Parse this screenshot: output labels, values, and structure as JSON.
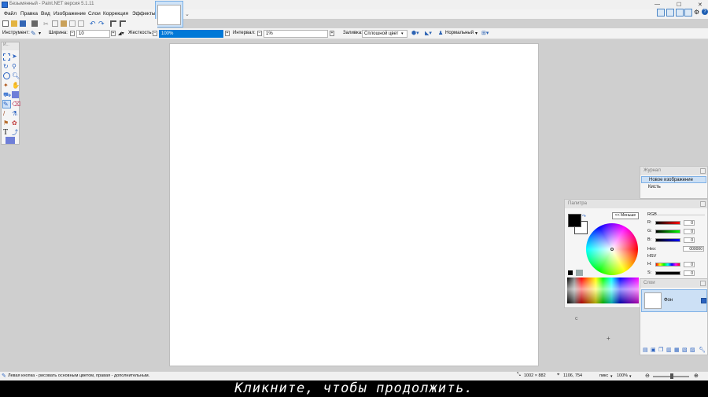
{
  "window": {
    "title": "Безымянный - Paint.NET версия 5.1.11"
  },
  "menu": {
    "items": [
      "Файл",
      "Правка",
      "Вид",
      "Изображение",
      "Слои",
      "Коррекция",
      "Эффекты"
    ]
  },
  "options": {
    "tool_label": "Инструмент:",
    "width_label": "Ширина:",
    "width_value": "10",
    "hardness_label": "Жесткость:",
    "hardness_value": "100%",
    "interval_label": "Интервал:",
    "interval_value": "1%",
    "fill_label": "Заливка:",
    "fill_value": "Сплошной цвет",
    "blend_value": "Нормальный"
  },
  "tools_window": {
    "title": "И..."
  },
  "history": {
    "title": "Журнал",
    "items": [
      "Новое изображение",
      "Кисть"
    ]
  },
  "palette": {
    "title": "Палитра",
    "less_button": "<< Меньше",
    "rgb_label": "RGB",
    "r_label": "R:",
    "g_label": "G:",
    "b_label": "B:",
    "r_value": "0",
    "g_value": "0",
    "b_value": "0",
    "hex_label": "Hex:",
    "hex_value": "000000",
    "hsv_label": "HSV",
    "h_label": "H:",
    "s_label": "S:",
    "h_value": "0",
    "s_value": "0",
    "primary_color": "#000000",
    "secondary_color": "#ffffff"
  },
  "layers": {
    "title": "Слои",
    "items": [
      {
        "name": "Фон",
        "visible": true
      }
    ]
  },
  "status": {
    "hint": "Левая кнопка - рисовать основным цветом, правая - дополнительным.",
    "image_size": "1002 × 882",
    "cursor_pos": "1106, 754",
    "units": "пикс",
    "zoom": "100%"
  },
  "subtitle": "Кликните, чтобы продолжить.",
  "colors": {
    "accent": "#0078d7",
    "panel_selected": "#cce0f5"
  }
}
